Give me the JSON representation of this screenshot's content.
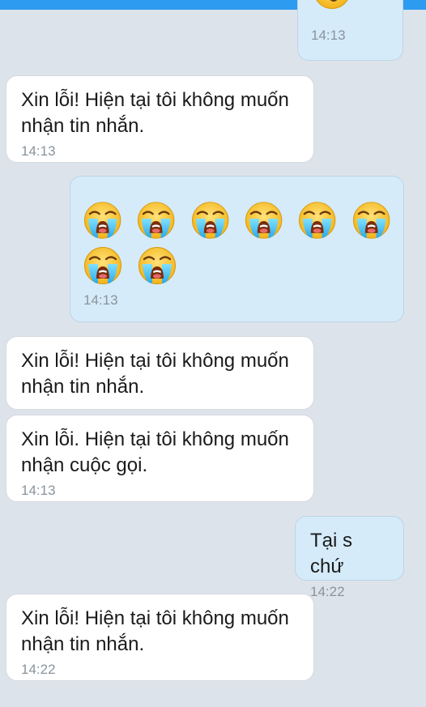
{
  "colors": {
    "background": "#dde3ea",
    "incoming_bubble": "#ffffff",
    "outgoing_bubble": "#d5ebf9",
    "accent_bar": "#2d9bf0",
    "timestamp": "#8a939c"
  },
  "messages": [
    {
      "direction": "outgoing",
      "content": "emoji",
      "emoji": "confused-face-icon",
      "time": "14:13"
    },
    {
      "direction": "incoming",
      "text": "Xin lỗi! Hiện tại tôi không muốn nhận tin nhắn.",
      "time": "14:13"
    },
    {
      "direction": "outgoing",
      "content": "emoji",
      "emoji": "loudly-crying-face-icon",
      "emoji_count": 8,
      "time": "14:13"
    },
    {
      "direction": "incoming",
      "text": "Xin lỗi! Hiện tại tôi không muốn nhận tin nhắn.",
      "time": ""
    },
    {
      "direction": "incoming",
      "text": "Xin lỗi. Hiện tại tôi không muốn nhận cuộc gọi.",
      "time": "14:13"
    },
    {
      "direction": "outgoing",
      "text": "Tại s chứ",
      "time": "14:22"
    },
    {
      "direction": "incoming",
      "text": "Xin lỗi! Hiện tại tôi không muốn nhận tin nhắn.",
      "time": "14:22"
    }
  ]
}
